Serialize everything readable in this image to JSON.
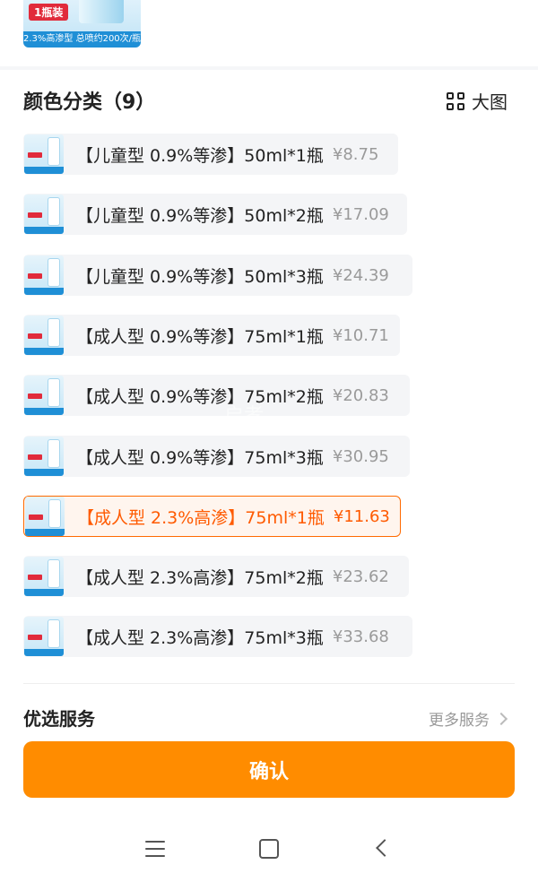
{
  "top_thumbnail": {
    "badge": "1瓶装",
    "caption": "2.3%高渗型 总喷约200次/瓶"
  },
  "header": {
    "title": "颜色分类（9）",
    "big_view_label": "大图"
  },
  "options": [
    {
      "label": "【儿童型 0.9%等渗】50ml*1瓶",
      "price": "¥8.75",
      "selected": false
    },
    {
      "label": "【儿童型 0.9%等渗】50ml*2瓶",
      "price": "¥17.09",
      "selected": false
    },
    {
      "label": "【儿童型 0.9%等渗】50ml*3瓶",
      "price": "¥24.39",
      "selected": false
    },
    {
      "label": "【成人型 0.9%等渗】75ml*1瓶",
      "price": "¥10.71",
      "selected": false
    },
    {
      "label": "【成人型 0.9%等渗】75ml*2瓶",
      "price": "¥20.83",
      "selected": false
    },
    {
      "label": "【成人型 0.9%等渗】75ml*3瓶",
      "price": "¥30.95",
      "selected": false
    },
    {
      "label": "【成人型 2.3%高渗】75ml*1瓶",
      "price": "¥11.63",
      "selected": true
    },
    {
      "label": "【成人型 2.3%高渗】75ml*2瓶",
      "price": "¥23.62",
      "selected": false
    },
    {
      "label": "【成人型 2.3%高渗】75ml*3瓶",
      "price": "¥33.68",
      "selected": false
    }
  ],
  "watermark": "启孝",
  "services": {
    "title": "优选服务",
    "more_label": "更多服务"
  },
  "confirm_label": "确认",
  "colors": {
    "accent": "#ff8c00",
    "selected_text": "#ff5a00",
    "badge_red": "#e12b3b"
  },
  "icons": {
    "big_view": "grid-icon",
    "more": "chevron-right-icon",
    "nav_menu": "menu-icon",
    "nav_home": "home-icon",
    "nav_back": "back-icon"
  }
}
